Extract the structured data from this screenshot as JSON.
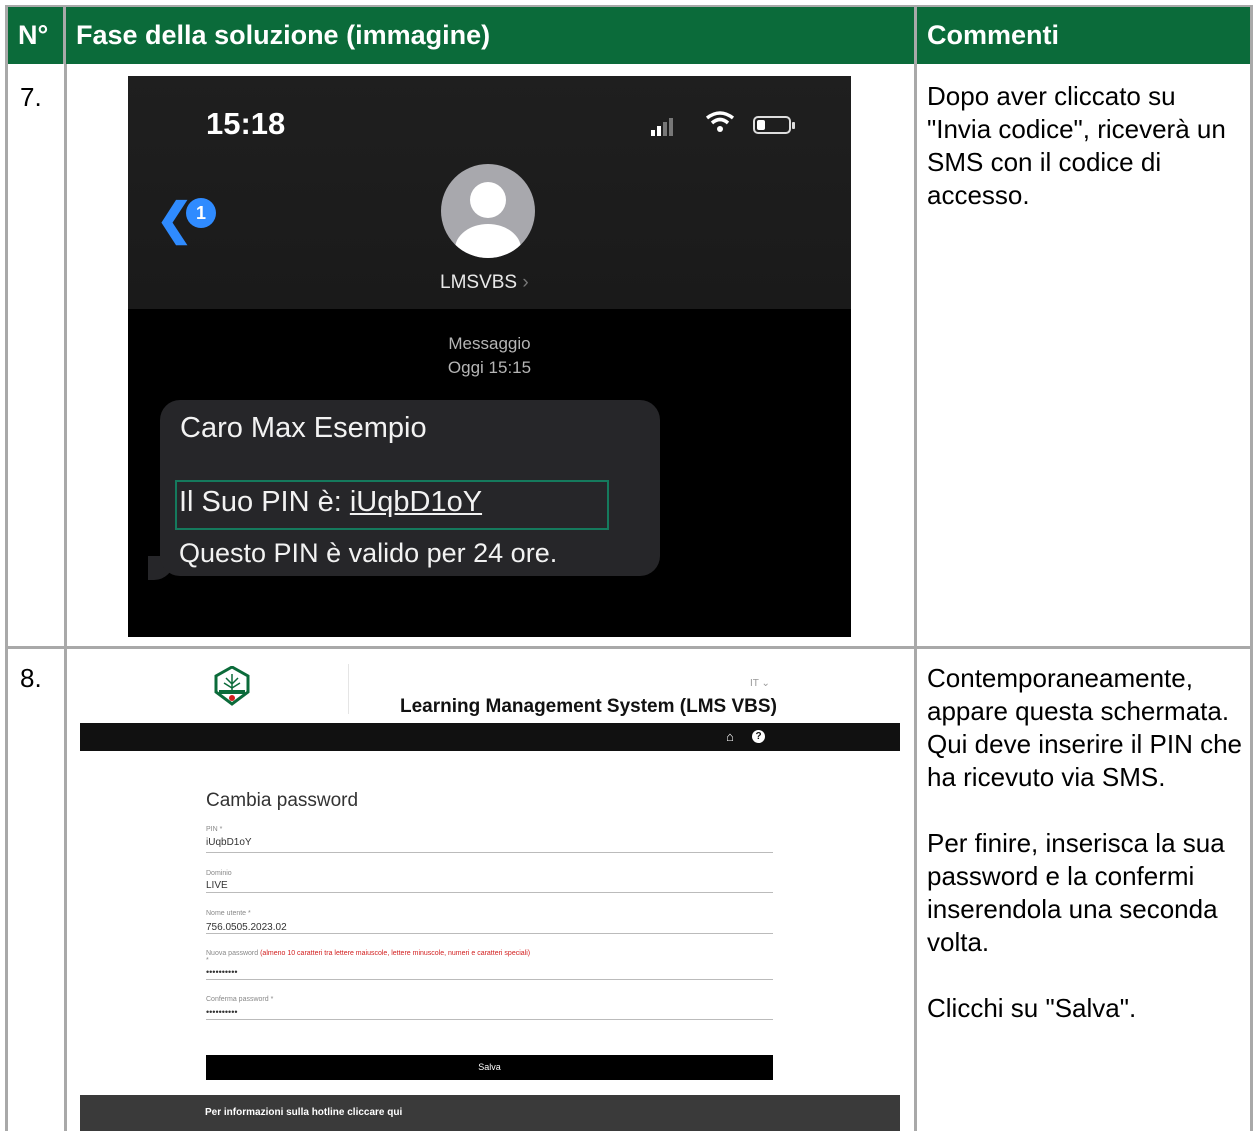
{
  "header": {
    "col_num": "N°",
    "col_step": "Fase della soluzione (immagine)",
    "col_comments": "Commenti"
  },
  "rows": [
    {
      "num": "7.",
      "comment": [
        "Dopo aver cliccato su \"Invia codice\", riceverà un SMS con il codice di accesso."
      ],
      "phone": {
        "time": "15:18",
        "back_badge": "1",
        "contact": "LMSVBS",
        "meta_type": "Messaggio",
        "meta_time": "Oggi  15:15",
        "sms_line1": "Caro Max Esempio",
        "sms_pin_prefix": "Il Suo PIN è: ",
        "sms_pin": "iUqbD1oY",
        "sms_line3": "Questo PIN è valido per 24 ore."
      }
    },
    {
      "num": "8.",
      "comment": [
        "Contemporaneamente, appare questa schermata. Qui deve inserire il PIN che ha ricevuto via SMS.",
        "Per finire, inserisca la sua password e la confermi inserendola una seconda volta.",
        "Clicchi su \"Salva\"."
      ],
      "lms": {
        "lang": "IT",
        "title": "Learning Management System (LMS VBS)",
        "form_title": "Cambia password",
        "pin_label": "PIN *",
        "pin_value": "iUqbD1oY",
        "domain_label": "Dominio",
        "domain_value": "LIVE",
        "user_label": "Nome utente *",
        "user_value": "756.0505.2023.02",
        "newpw_label": "Nuova password",
        "newpw_hint": "(almeno 10 caratteri tra lettere maiuscole, lettere minuscole, numeri e caratteri speciali)",
        "newpw_value": "••••••••••",
        "confirm_label": "Conferma password *",
        "confirm_value": "••••••••••",
        "save_label": "Salva",
        "footer": "Per informazioni sulla hotline cliccare qui"
      }
    }
  ]
}
